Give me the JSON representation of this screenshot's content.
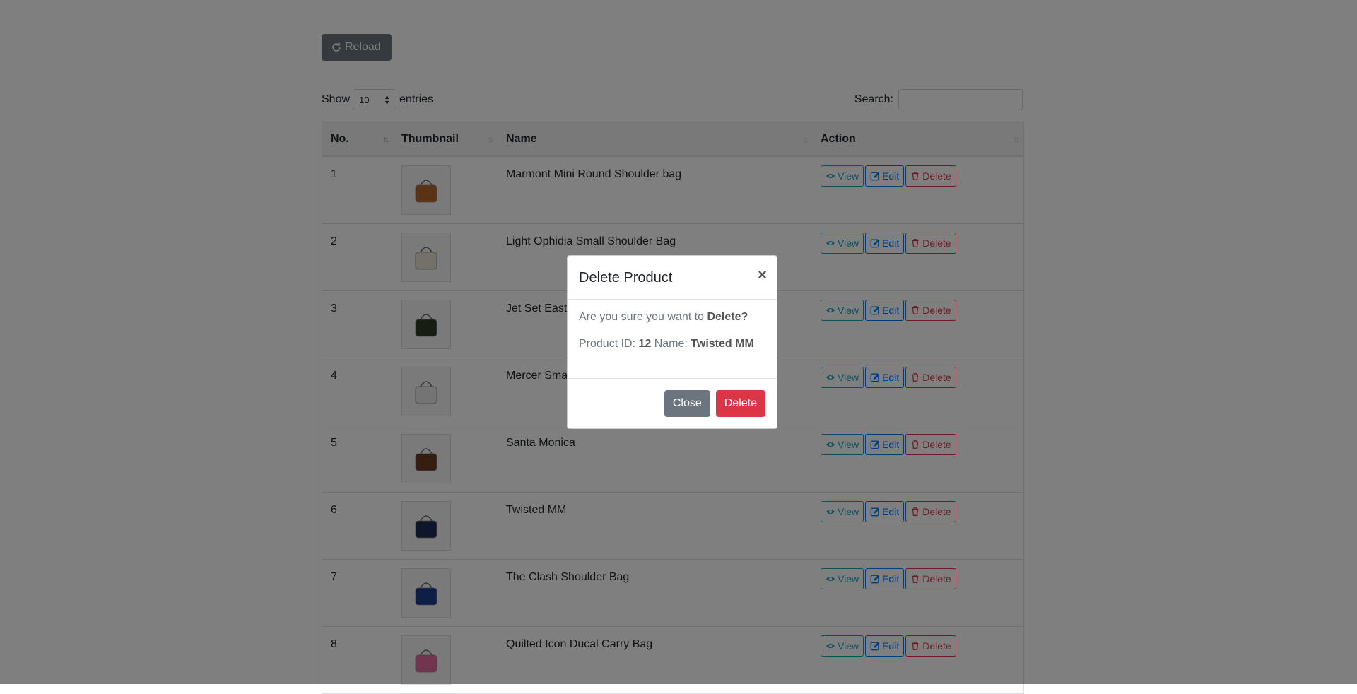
{
  "toolbar": {
    "reload_label": "Reload"
  },
  "length": {
    "show": "Show",
    "value": "10",
    "entries": "entries"
  },
  "search": {
    "label": "Search:",
    "value": ""
  },
  "table": {
    "headers": [
      "No.",
      "Thumbnail",
      "Name",
      "Action"
    ],
    "action_labels": {
      "view": "View",
      "edit": "Edit",
      "delete": "Delete"
    },
    "rows": [
      {
        "no": "1",
        "name": "Marmont Mini Round Shoulder bag"
      },
      {
        "no": "2",
        "name": "Light Ophidia Small Shoulder Bag"
      },
      {
        "no": "3",
        "name": "Jet Set East"
      },
      {
        "no": "4",
        "name": "Mercer Sma"
      },
      {
        "no": "5",
        "name": "Santa Monica"
      },
      {
        "no": "6",
        "name": "Twisted MM"
      },
      {
        "no": "7",
        "name": "The Clash Shoulder Bag"
      },
      {
        "no": "8",
        "name": "Quilted Icon Ducal Carry Bag"
      }
    ]
  },
  "modal": {
    "title": "Delete Product",
    "close_symbol": "×",
    "question_prefix": "Are you sure you want to ",
    "question_bold": "Delete?",
    "id_label": "Product ID: ",
    "id_value": "12",
    "name_label": " Name: ",
    "name_value": "Twisted MM",
    "close_label": "Close",
    "delete_label": "Delete"
  },
  "colors": {
    "overlay": "rgba(0,0,0,0.5)",
    "danger": "#dc3545",
    "secondary": "#6c757d",
    "info": "#17a2b8",
    "primary": "#007bff"
  }
}
